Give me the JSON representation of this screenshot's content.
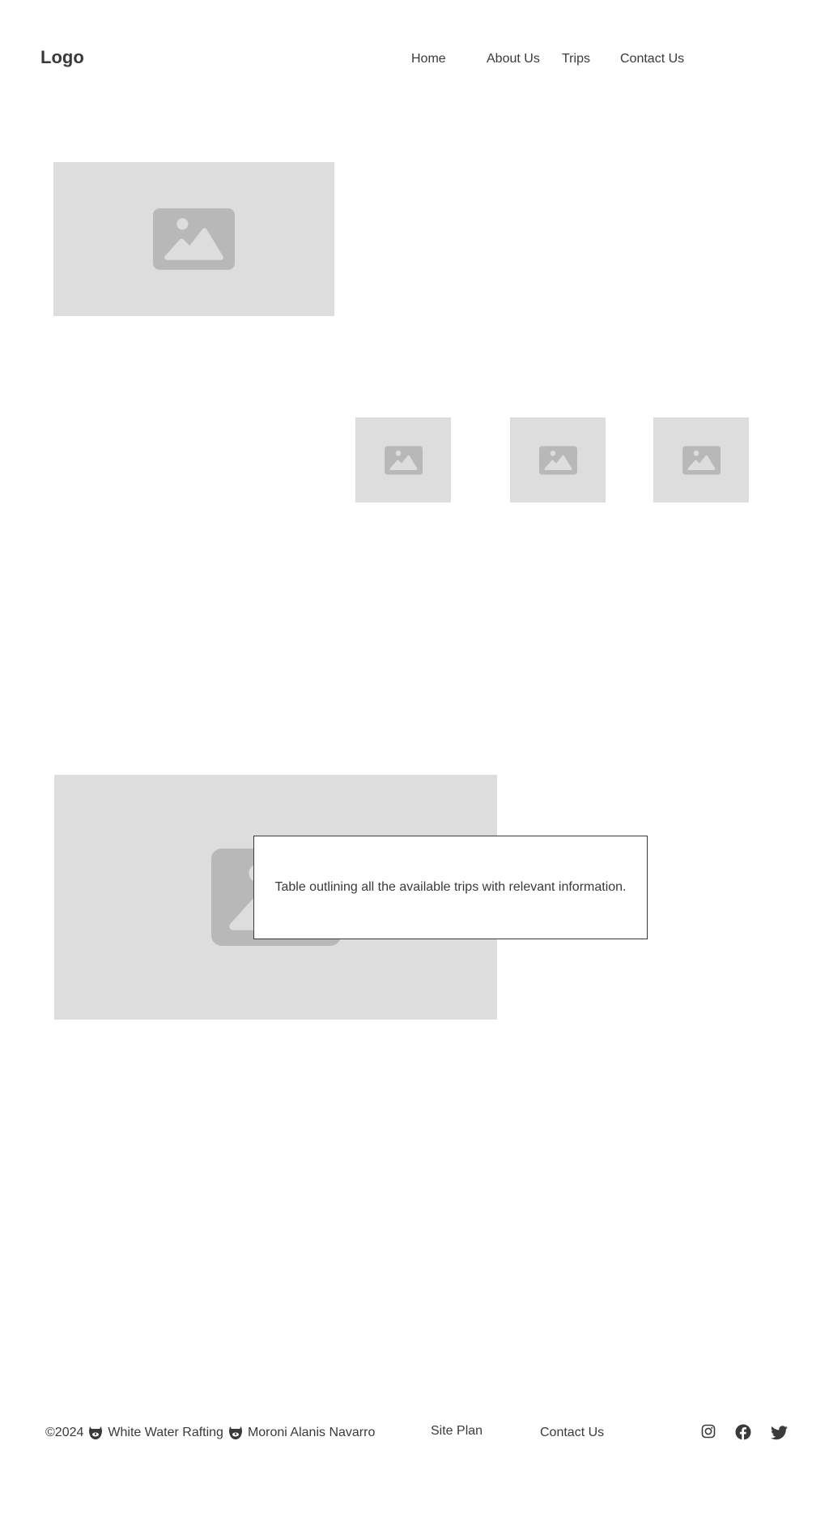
{
  "header": {
    "logo": "Logo",
    "nav": {
      "home": "Home",
      "about": "About Us",
      "trips": "Trips",
      "contact": "Contact Us"
    }
  },
  "main": {
    "hero_image_icon": "image-icon",
    "gallery_icons": [
      "image-icon",
      "image-icon",
      "image-icon"
    ],
    "feature_image_icon": "image-icon",
    "table_note": "Table outlining all the available trips with relevant information."
  },
  "footer": {
    "copyright": "©2024",
    "site_name": "White Water Rafting",
    "author": "Moroni Alanis Navarro",
    "links": {
      "site_plan": "Site Plan",
      "contact": "Contact Us"
    },
    "social": [
      "instagram-icon",
      "facebook-icon",
      "twitter-icon"
    ]
  },
  "colors": {
    "text": "#3a3a3a",
    "placeholder_bg": "#dddddd",
    "placeholder_icon": "#b8b8b8"
  }
}
